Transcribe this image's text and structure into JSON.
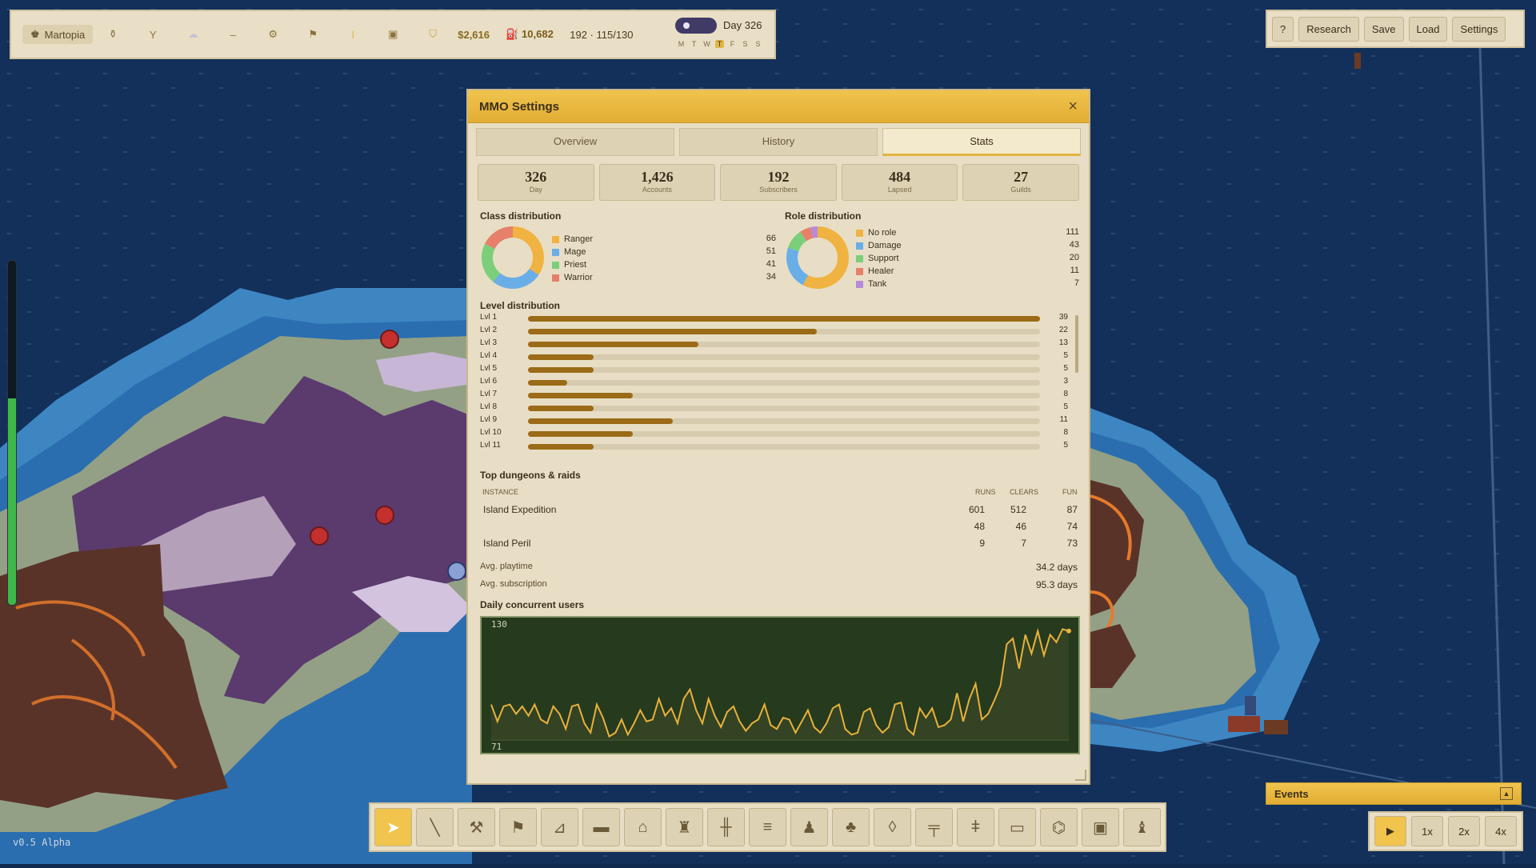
{
  "topbar": {
    "city": "Martopia",
    "money": "$2,616",
    "fuel": "10,682",
    "population": "192 · 115/130",
    "day": "Day 326",
    "weekdays": [
      "M",
      "T",
      "W",
      "T",
      "F",
      "S",
      "S"
    ],
    "current_weekday_index": 3,
    "icons": [
      "potion-icon",
      "antenna-icon",
      "cloud-icon",
      "dash-icon",
      "gear-icon",
      "flag-icon",
      "torch-icon",
      "tower-icon",
      "shield-icon"
    ]
  },
  "topright": {
    "help": "?",
    "research": "Research",
    "save": "Save",
    "load": "Load",
    "settings": "Settings"
  },
  "version": "v0.5 Alpha",
  "meter": {
    "level": 0.6
  },
  "dialog": {
    "title": "MMO Settings",
    "close": "×",
    "tabs": [
      "Overview",
      "History",
      "Stats"
    ],
    "active_tab": 2,
    "stats": [
      {
        "value": "326",
        "label": "Day"
      },
      {
        "value": "1,426",
        "label": "Accounts"
      },
      {
        "value": "192",
        "label": "Subscribers"
      },
      {
        "value": "484",
        "label": "Lapsed"
      },
      {
        "value": "27",
        "label": "Guilds"
      }
    ],
    "class_title": "Class distribution",
    "classes": [
      {
        "name": "Ranger",
        "value": 66,
        "color": "#f0b342"
      },
      {
        "name": "Mage",
        "value": 51,
        "color": "#6aaee8"
      },
      {
        "name": "Priest",
        "value": 41,
        "color": "#7ccf7a"
      },
      {
        "name": "Warrior",
        "value": 34,
        "color": "#e6806a"
      }
    ],
    "role_title": "Role distribution",
    "roles": [
      {
        "name": "No role",
        "value": 111,
        "color": "#f0b342"
      },
      {
        "name": "Damage",
        "value": 43,
        "color": "#6aaee8"
      },
      {
        "name": "Support",
        "value": 20,
        "color": "#7ccf7a"
      },
      {
        "name": "Healer",
        "value": 11,
        "color": "#e6806a"
      },
      {
        "name": "Tank",
        "value": 7,
        "color": "#b68ad8"
      }
    ],
    "level_title": "Level distribution",
    "levels": [
      {
        "label": "Lvl 1",
        "count": 39
      },
      {
        "label": "Lvl 2",
        "count": 22
      },
      {
        "label": "Lvl 3",
        "count": 13
      },
      {
        "label": "Lvl 4",
        "count": 5
      },
      {
        "label": "Lvl 5",
        "count": 5
      },
      {
        "label": "Lvl 6",
        "count": 3
      },
      {
        "label": "Lvl 7",
        "count": 8
      },
      {
        "label": "Lvl 8",
        "count": 5
      },
      {
        "label": "Lvl 9",
        "count": 11
      },
      {
        "label": "Lvl 10",
        "count": 8
      },
      {
        "label": "Lvl 11",
        "count": 5
      }
    ],
    "dungeons_title": "Top dungeons & raids",
    "dungeon_headers": {
      "instance": "INSTANCE",
      "runs": "RUNS",
      "clears": "CLEARS",
      "fun": "FUN"
    },
    "dungeons": [
      {
        "name": "Island Expedition",
        "runs": "601",
        "clears": "512",
        "fun": "87"
      },
      {
        "name": "",
        "runs": "48",
        "clears": "46",
        "fun": "74"
      },
      {
        "name": "Island Peril",
        "runs": "9",
        "clears": "7",
        "fun": "73"
      }
    ],
    "avg_playtime_label": "Avg. playtime",
    "avg_playtime": "34.2 days",
    "avg_sub_label": "Avg. subscription",
    "avg_sub": "95.3 days",
    "ccu_title": "Daily concurrent users"
  },
  "chart_data": {
    "type": "line",
    "title": "Daily concurrent users",
    "ylim": [
      71,
      130
    ],
    "tick_labels": {
      "top": "130",
      "bottom": "71"
    },
    "line_color": "#e9b13b",
    "values": [
      89,
      80,
      88,
      89,
      84,
      88,
      83,
      89,
      81,
      79,
      88,
      84,
      76,
      88,
      89,
      79,
      74,
      89,
      82,
      72,
      74,
      81,
      73,
      79,
      86,
      80,
      81,
      92,
      83,
      87,
      79,
      92,
      97,
      86,
      79,
      92,
      83,
      77,
      85,
      88,
      80,
      75,
      79,
      81,
      89,
      78,
      76,
      82,
      81,
      74,
      80,
      86,
      77,
      74,
      79,
      87,
      89,
      76,
      73,
      74,
      85,
      87,
      78,
      74,
      77,
      89,
      90,
      76,
      73,
      87,
      82,
      87,
      77,
      78,
      81,
      95,
      80,
      92,
      100,
      81,
      84,
      91,
      99,
      121,
      124,
      108,
      126,
      116,
      128,
      115,
      126,
      122,
      129,
      128
    ]
  },
  "toolbar": {
    "tools": [
      "cursor-icon",
      "pickaxe-icon",
      "hammer-icon",
      "flag-icon",
      "wall-icon",
      "chest-icon",
      "house-icon",
      "castle-icon",
      "gate-icon",
      "bridge-icon",
      "statue-icon",
      "tree-icon",
      "rock-icon",
      "bench-icon",
      "lamp-icon",
      "rug-icon",
      "shop-icon",
      "tower-icon",
      "lighthouse-icon"
    ],
    "tool_glyphs": [
      "➤",
      "╲",
      "⚒",
      "⚑",
      "⊿",
      "▬",
      "⌂",
      "♜",
      "╫",
      "≡",
      "♟",
      "♣",
      "◊",
      "╤",
      "ǂ",
      "▭",
      "⌬",
      "▣",
      "♝"
    ],
    "selected": 0
  },
  "events": {
    "title": "Events",
    "toggle": "▲"
  },
  "speed": {
    "play": "▶",
    "options": [
      "1x",
      "2x",
      "4x"
    ]
  }
}
